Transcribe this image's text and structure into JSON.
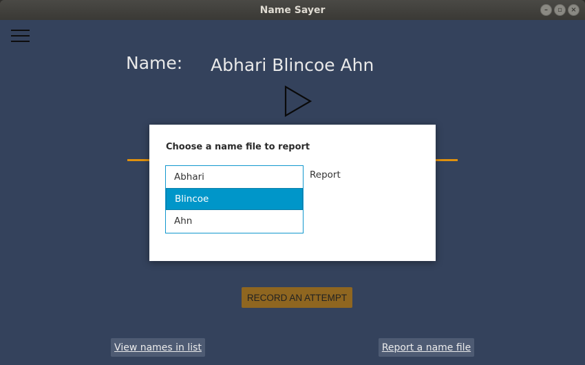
{
  "window": {
    "title": "Name Sayer",
    "controls": [
      {
        "name": "minimize-icon",
        "glyph": "–"
      },
      {
        "name": "maximize-icon",
        "glyph": "▫"
      },
      {
        "name": "close-icon",
        "glyph": "×"
      }
    ]
  },
  "main": {
    "name_label": "Name:",
    "name_value": "Abhari Blincoe Ahn",
    "record_button": "RECORD AN ATTEMPT",
    "view_names_button": "View names in list",
    "report_button": "Report a name file"
  },
  "dialog": {
    "title": "Choose a name file to report",
    "items": [
      "Abhari",
      "Blincoe",
      "Ahn"
    ],
    "selected": "Blincoe",
    "report_label": "Report"
  },
  "colors": {
    "background": "#34425c",
    "accent_orange": "#e0910e",
    "selection_blue": "#0096c9"
  }
}
